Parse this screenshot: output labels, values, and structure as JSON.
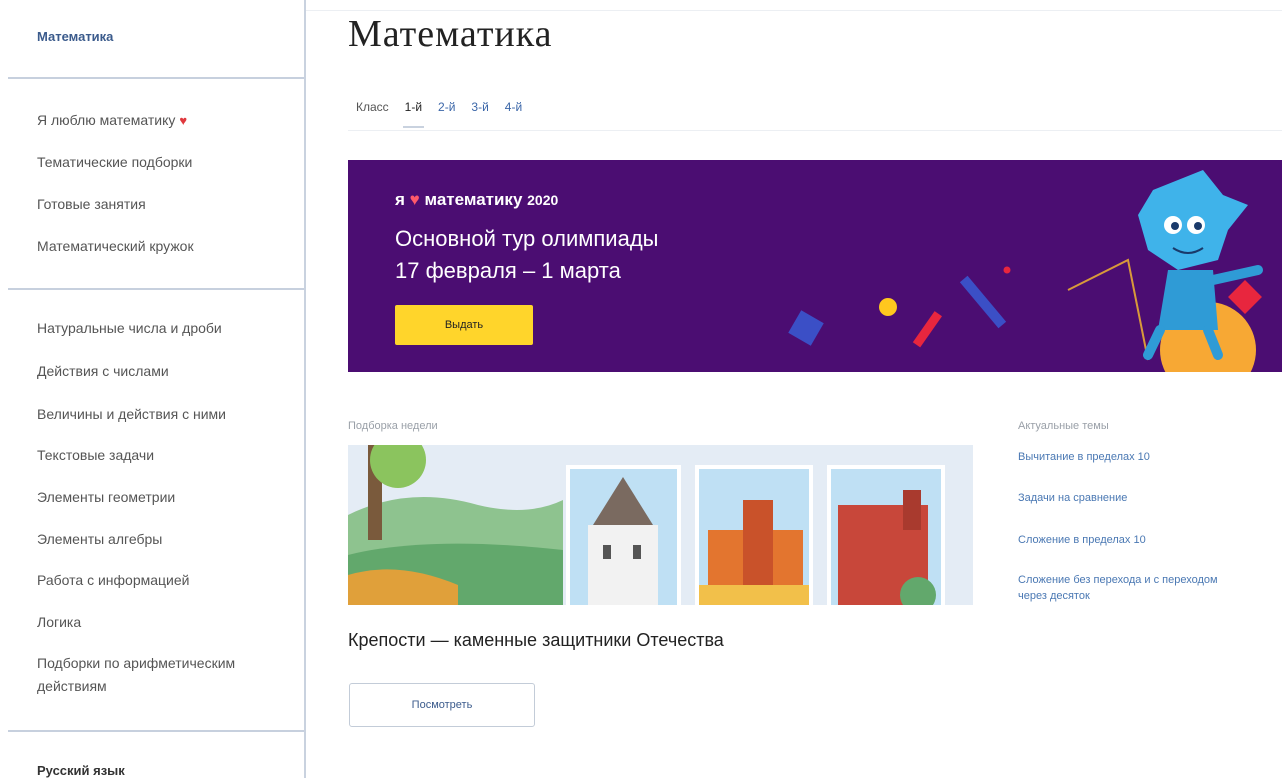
{
  "sidebar": {
    "current": "Математика",
    "section1": [
      {
        "label": "Я люблю математику",
        "heart": "♥"
      },
      {
        "label": "Тематические подборки"
      },
      {
        "label": "Готовые занятия"
      },
      {
        "label": "Математический кружок"
      }
    ],
    "section2": [
      {
        "label": "Натуральные числа и дроби"
      },
      {
        "label": "Действия с числами"
      },
      {
        "label": "Величины и действия с ними"
      },
      {
        "label": "Текстовые задачи"
      },
      {
        "label": "Элементы геометрии"
      },
      {
        "label": "Элементы алгебры"
      },
      {
        "label": "Работа с информацией"
      },
      {
        "label": "Логика"
      },
      {
        "label": "Подборки по арифметическим действиям"
      }
    ],
    "bottom": "Русский язык"
  },
  "main": {
    "title": "Математика",
    "grades_label": "Класс",
    "grades": [
      "1-й",
      "2-й",
      "3-й",
      "4-й"
    ],
    "active_grade": "1-й"
  },
  "banner": {
    "brand_prefix": "я",
    "brand_heart": "♥",
    "brand_text": "математику",
    "brand_year": "2020",
    "line1": "Основной тур олимпиады",
    "line2": "17 февраля – 1 марта",
    "button": "Выдать",
    "background": "#4b0d72",
    "button_color": "#ffd52b"
  },
  "collection": {
    "label": "Подборка недели",
    "title": "Крепости — каменные защитники Отечества",
    "button": "Посмотреть"
  },
  "topics": {
    "label": "Актуальные темы",
    "items": [
      "Вычитание в пределах 10",
      "Задачи на сравнение",
      "Сложение в пределах 10",
      "Сложение без перехода и с переходом через десяток"
    ]
  },
  "colors": {
    "link": "#4a78b3",
    "heart": "#e0393e"
  }
}
